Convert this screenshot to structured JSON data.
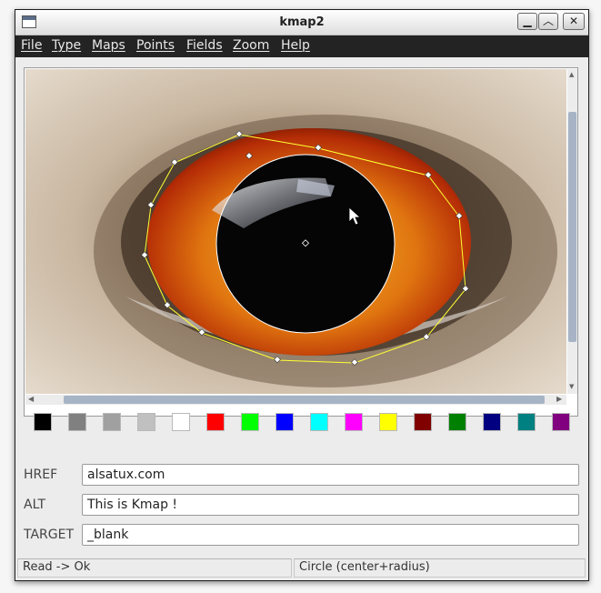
{
  "window": {
    "title": "kmap2"
  },
  "menu": [
    "File",
    "Type",
    "Maps",
    "Points",
    "Fields",
    "Zoom",
    "Help"
  ],
  "palette": [
    "#000000",
    "#808080",
    "#a0a0a0",
    "#c0c0c0",
    "#ffffff",
    "#ff0000",
    "#00ff00",
    "#0000ff",
    "#00ffff",
    "#ff00ff",
    "#ffff00",
    "#800000",
    "#008000",
    "#000080",
    "#008080",
    "#800080"
  ],
  "fields": {
    "href": {
      "label": "HREF",
      "value": "alsatux.com"
    },
    "alt": {
      "label": "ALT",
      "value": "This is Kmap !"
    },
    "target": {
      "label": "TARGET",
      "value": "_blank"
    }
  },
  "status": {
    "left": "Read -> Ok",
    "right": "Circle (center+radius)"
  },
  "icons": {
    "app": "window-icon",
    "minimize": "minimize-icon",
    "maximize": "maximize-icon",
    "close": "close-icon"
  }
}
